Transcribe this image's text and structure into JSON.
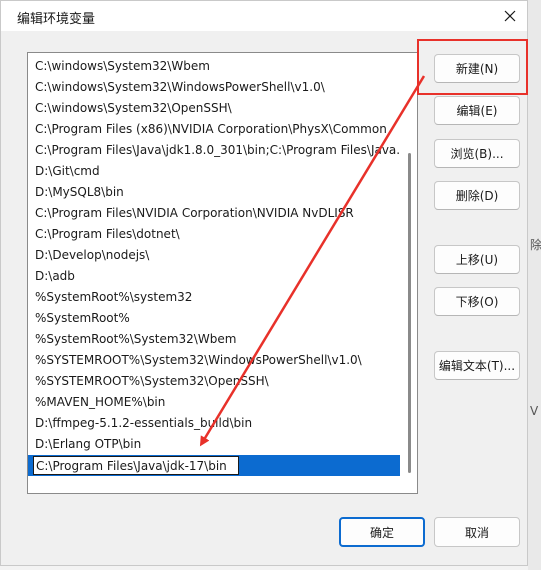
{
  "window": {
    "title": "编辑环境变量",
    "close_glyph": "✕"
  },
  "paths": [
    "C:\\windows\\System32\\Wbem",
    "C:\\windows\\System32\\WindowsPowerShell\\v1.0\\",
    "C:\\windows\\System32\\OpenSSH\\",
    "C:\\Program Files (x86)\\NVIDIA Corporation\\PhysX\\Common",
    "C:\\Program Files\\Java\\jdk1.8.0_301\\bin;C:\\Program Files\\Java...",
    "D:\\Git\\cmd",
    "D:\\MySQL8\\bin",
    "C:\\Program Files\\NVIDIA Corporation\\NVIDIA NvDLISR",
    "C:\\Program Files\\dotnet\\",
    "D:\\Develop\\nodejs\\",
    "D:\\adb",
    "%SystemRoot%\\system32",
    "%SystemRoot%",
    "%SystemRoot%\\System32\\Wbem",
    "%SYSTEMROOT%\\System32\\WindowsPowerShell\\v1.0\\",
    "%SYSTEMROOT%\\System32\\OpenSSH\\",
    "%MAVEN_HOME%\\bin",
    "D:\\ffmpeg-5.1.2-essentials_build\\bin",
    "D:\\Erlang OTP\\bin"
  ],
  "editing": {
    "value": "C:\\Program Files\\Java\\jdk-17\\bin"
  },
  "buttons": {
    "new": "新建(N)",
    "edit": "编辑(E)",
    "browse": "浏览(B)...",
    "delete": "删除(D)",
    "move_up": "上移(U)",
    "move_down": "下移(O)",
    "edit_text": "编辑文本(T)...",
    "ok": "确定",
    "cancel": "取消"
  },
  "background": {
    "glyph_1": "除",
    "glyph_2": "V"
  },
  "colors": {
    "accent": "#0c6bd0",
    "annotation_red": "#e8312a"
  }
}
